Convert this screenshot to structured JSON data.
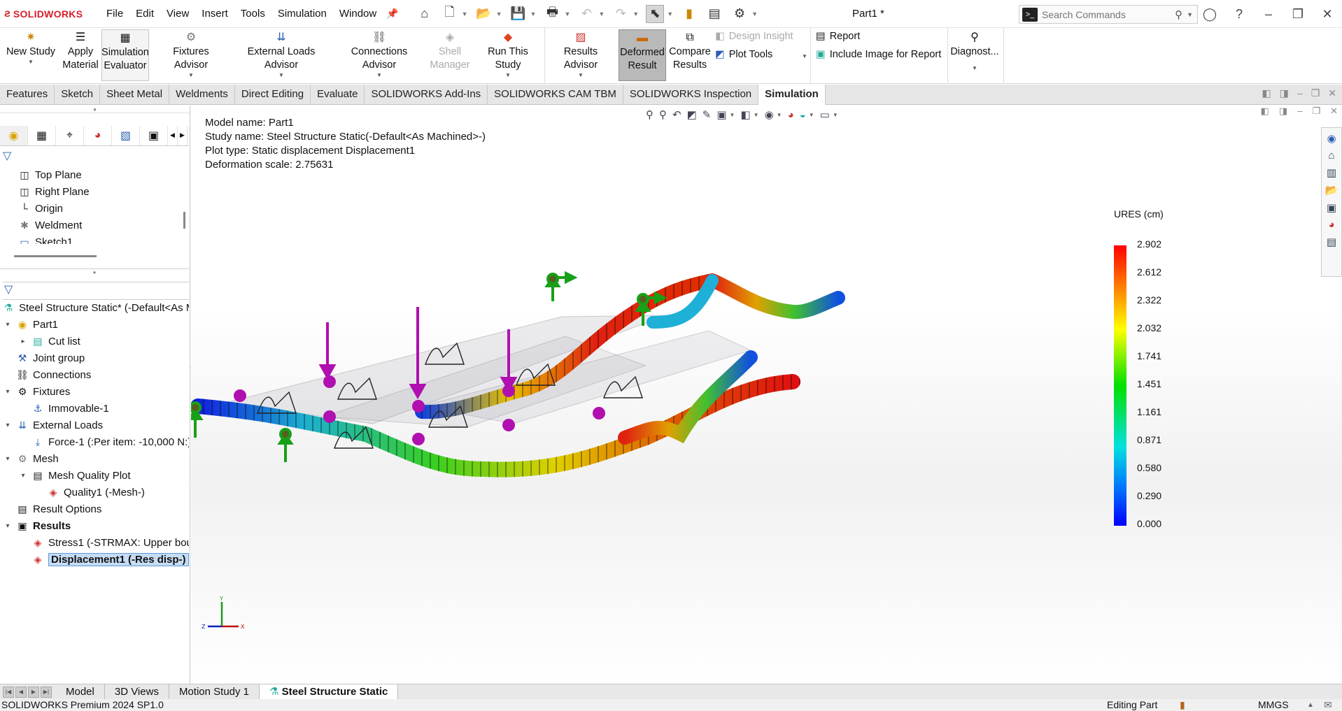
{
  "app": {
    "brand": "SOLIDWORKS",
    "document_title": "Part1 *"
  },
  "menu": [
    "File",
    "Edit",
    "View",
    "Insert",
    "Tools",
    "Simulation",
    "Window"
  ],
  "search": {
    "placeholder": "Search Commands"
  },
  "ribbon": {
    "new_study": "New Study",
    "apply_material_1": "Apply",
    "apply_material_2": "Material",
    "sim_eval_1": "Simulation",
    "sim_eval_2": "Evaluator",
    "fixtures_advisor": "Fixtures Advisor",
    "external_loads_advisor": "External Loads Advisor",
    "connections_advisor": "Connections Advisor",
    "shell_manager_1": "Shell",
    "shell_manager_2": "Manager",
    "run_this_study": "Run This Study",
    "results_advisor": "Results Advisor",
    "deformed_result_1": "Deformed",
    "deformed_result_2": "Result",
    "compare_results_1": "Compare",
    "compare_results_2": "Results",
    "design_insight": "Design Insight",
    "plot_tools": "Plot Tools",
    "report": "Report",
    "include_image": "Include Image for Report",
    "diagnostics": "Diagnost..."
  },
  "tabs": [
    "Features",
    "Sketch",
    "Sheet Metal",
    "Weldments",
    "Direct Editing",
    "Evaluate",
    "SOLIDWORKS Add-Ins",
    "SOLIDWORKS CAM TBM",
    "SOLIDWORKS Inspection",
    "Simulation"
  ],
  "feature_tree": {
    "items": [
      "Top Plane",
      "Right Plane",
      "Origin",
      "Weldment",
      "Sketch1"
    ]
  },
  "sim_tree": {
    "study": "Steel Structure Static* (-Default<As M",
    "part": "Part1",
    "cut_list": "Cut list",
    "joint_group": "Joint group",
    "connections": "Connections",
    "fixtures": "Fixtures",
    "immovable": "Immovable-1",
    "external_loads": "External Loads",
    "force": "Force-1 (:Per item: -10,000 N:)",
    "mesh": "Mesh",
    "mesh_quality_plot": "Mesh Quality Plot",
    "quality1": "Quality1 (-Mesh-)",
    "result_options": "Result Options",
    "results": "Results",
    "stress1": "Stress1 (-STRMAX: Upper bour",
    "displacement1": "Displacement1 (-Res disp-)"
  },
  "plot_info": {
    "model_name": "Model name: Part1",
    "study_name": "Study name: Steel Structure Static(-Default<As Machined>-)",
    "plot_type": "Plot type: Static displacement Displacement1",
    "deformation_scale": "Deformation scale: 2.75631"
  },
  "legend": {
    "title": "URES (cm)",
    "ticks": [
      "2.902",
      "2.612",
      "2.322",
      "2.032",
      "1.741",
      "1.451",
      "1.161",
      "0.871",
      "0.580",
      "0.290",
      "0.000"
    ],
    "max_color": "#ff0000",
    "min_color": "#0000ff"
  },
  "triad": {
    "x": "X",
    "y": "Y",
    "z": "Z"
  },
  "bottom_tabs": [
    "Model",
    "3D Views",
    "Motion Study 1",
    "Steel Structure Static"
  ],
  "status": {
    "version": "SOLIDWORKS Premium 2024 SP1.0",
    "mode": "Editing Part",
    "units": "MMGS"
  }
}
